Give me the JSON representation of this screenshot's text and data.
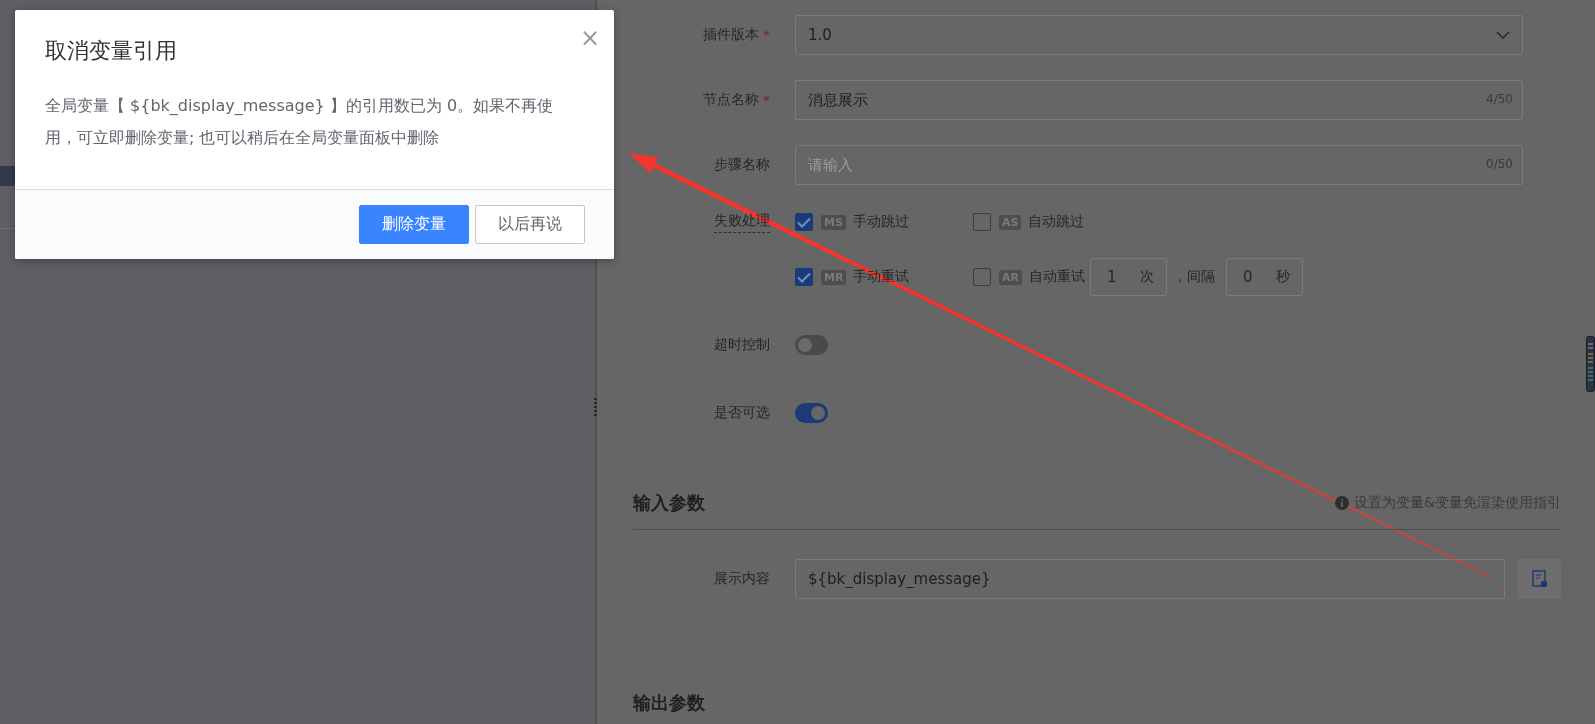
{
  "dialog": {
    "title": "取消变量引用",
    "message": "全局变量【 ${bk_display_message} 】的引用数已为 0。如果不再使用，可立即删除变量; 也可以稍后在全局变量面板中删除",
    "close": "×",
    "buttons": [
      {
        "label": "删除变量",
        "kind": "primary"
      },
      {
        "label": "以后再说",
        "kind": "default"
      }
    ]
  },
  "form": {
    "fields": [
      {
        "label": "插件版本",
        "required_mark": "*",
        "kind": "select",
        "value": "1.0"
      },
      {
        "label": "节点名称",
        "required_mark": "*",
        "kind": "text",
        "value": "消息展示",
        "counter": "4/50"
      },
      {
        "label": "步骤名称",
        "kind": "text",
        "placeholder": "请输入",
        "counter": "0/50"
      }
    ],
    "failure": {
      "label": "失败处理",
      "rows": [
        {
          "options": [
            {
              "badge": "MS",
              "label": "手动跳过",
              "checked": true
            },
            {
              "badge": "AS",
              "label": "自动跳过",
              "checked": false
            }
          ]
        },
        {
          "options": [
            {
              "badge": "MR",
              "label": "手动重试",
              "checked": true
            },
            {
              "badge": "AR",
              "label": "自动重试",
              "checked": false,
              "count": "1",
              "count_unit": "次",
              "interval_label": "，间隔",
              "interval": "0",
              "interval_unit": "秒"
            }
          ]
        }
      ]
    },
    "switches": [
      {
        "label": "超时控制",
        "on": false
      },
      {
        "label": "是否可选",
        "on": true
      }
    ],
    "input_section": {
      "title": "输入参数",
      "hint": "设置为变量&变量免渲染使用指引",
      "params": [
        {
          "label": "展示内容",
          "value": "${bk_display_message}"
        }
      ]
    },
    "output_section": {
      "title": "输出参数"
    }
  }
}
